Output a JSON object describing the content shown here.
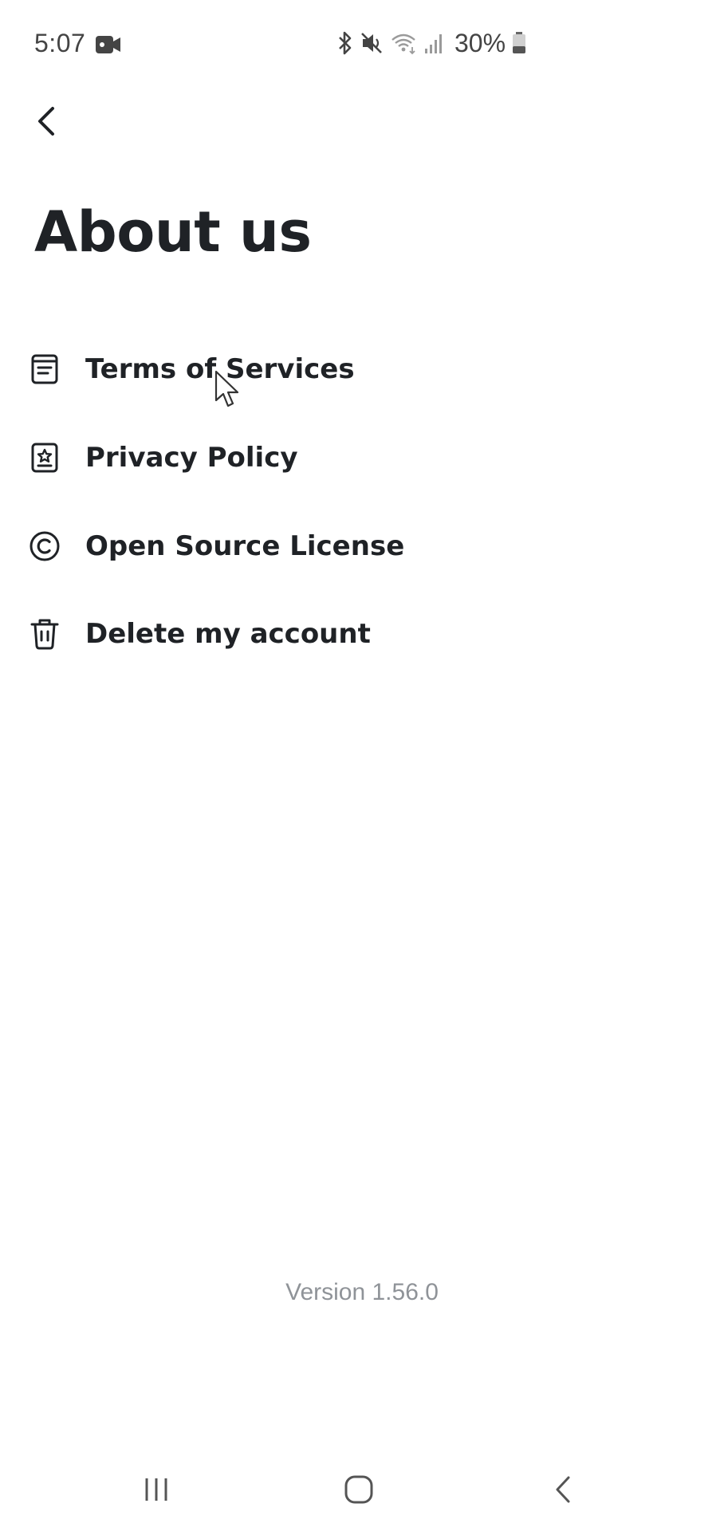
{
  "status_bar": {
    "time": "5:07",
    "battery_percent": "30%",
    "icons": [
      "video-camera-icon",
      "bluetooth-icon",
      "mute-icon",
      "wifi-icon",
      "signal-icon",
      "battery-icon"
    ]
  },
  "header": {
    "back_icon": "chevron-left-icon",
    "title": "About us"
  },
  "menu": {
    "items": [
      {
        "label": "Terms of Services",
        "icon": "document-icon"
      },
      {
        "label": "Privacy Policy",
        "icon": "badge-star-icon"
      },
      {
        "label": "Open Source License",
        "icon": "copyright-icon"
      },
      {
        "label": "Delete my account",
        "icon": "trash-icon"
      }
    ]
  },
  "footer": {
    "version": "Version 1.56.0"
  },
  "nav_bar": {
    "icons": [
      "recents-icon",
      "home-icon",
      "back-icon"
    ]
  },
  "colors": {
    "text_primary": "#1f2226",
    "text_muted": "#8f9398",
    "background": "#ffffff"
  }
}
